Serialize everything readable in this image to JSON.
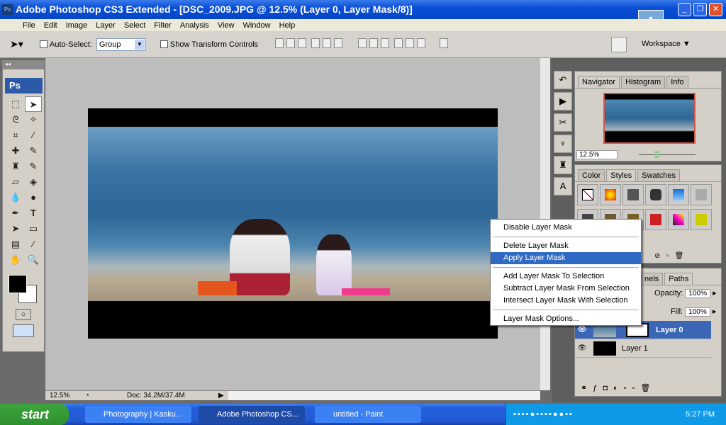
{
  "window": {
    "title": "Adobe Photoshop CS3 Extended - [DSC_2009.JPG @ 12.5% (Layer 0, Layer Mask/8)]",
    "app_icon": "Ps"
  },
  "menu": [
    "File",
    "Edit",
    "Image",
    "Layer",
    "Select",
    "Filter",
    "Analysis",
    "View",
    "Window",
    "Help"
  ],
  "options": {
    "auto_select_label": "Auto-Select:",
    "auto_select_value": "Group",
    "show_transform": "Show Transform Controls",
    "workspace": "Workspace"
  },
  "toolbox": {
    "logo": "Ps"
  },
  "status": {
    "zoom": "12.5%",
    "doc": "Doc: 34.2M/37.4M"
  },
  "navigator": {
    "tabs": [
      "Navigator",
      "Histogram",
      "Info"
    ],
    "zoom": "12.5%"
  },
  "styles": {
    "tabs": [
      "Color",
      "Styles",
      "Swatches"
    ]
  },
  "layers": {
    "tabs": [
      "nels",
      "Paths"
    ],
    "opacity_label": "Opacity:",
    "opacity": "100%",
    "fill_label": "Fill:",
    "fill": "100%",
    "items": [
      {
        "name": "Layer 0",
        "selected": true
      },
      {
        "name": "Layer 1",
        "selected": false
      }
    ]
  },
  "context_menu": {
    "items": [
      "Disable Layer Mask",
      "Delete Layer Mask",
      "Apply Layer Mask",
      "Add Layer Mask To Selection",
      "Subtract Layer Mask From Selection",
      "Intersect Layer Mask With Selection",
      "Layer Mask Options..."
    ],
    "highlighted": "Apply Layer Mask"
  },
  "taskbar": {
    "start": "start",
    "tasks": [
      "Photography | Kasku...",
      "Adobe Photoshop CS...",
      "untitled - Paint"
    ],
    "active": "Adobe Photoshop CS...",
    "clock": "5:27 PM"
  }
}
